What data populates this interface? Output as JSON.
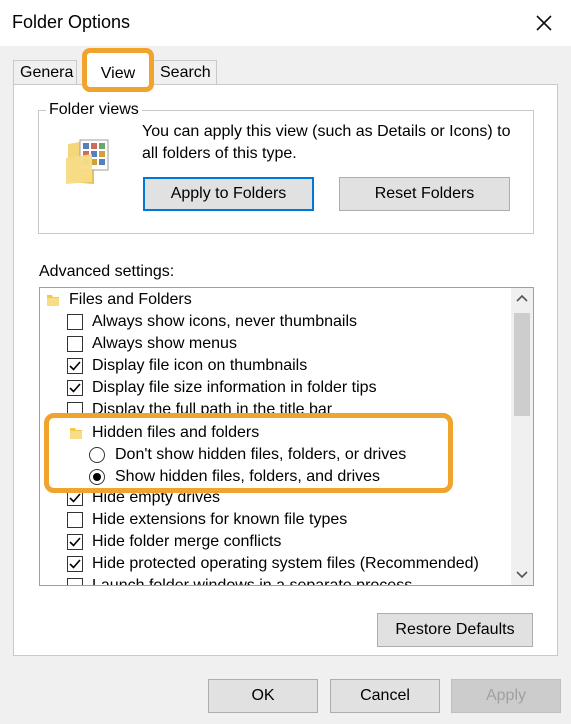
{
  "window": {
    "title": "Folder Options"
  },
  "tabs": [
    {
      "label": "Genera"
    },
    {
      "label": "View"
    },
    {
      "label": "Search"
    }
  ],
  "folder_views": {
    "label": "Folder views",
    "description": "You can apply this view (such as Details or Icons) to all folders of this type.",
    "apply_button": "Apply to Folders",
    "reset_button": "Reset Folders"
  },
  "advanced": {
    "label": "Advanced settings:",
    "items": [
      {
        "type": "folder",
        "label": "Files and Folders"
      },
      {
        "type": "checkbox",
        "label": "Always show icons, never thumbnails",
        "checked": false
      },
      {
        "type": "checkbox",
        "label": "Always show menus",
        "checked": false
      },
      {
        "type": "checkbox",
        "label": "Display file icon on thumbnails",
        "checked": true
      },
      {
        "type": "checkbox",
        "label": "Display file size information in folder tips",
        "checked": true
      },
      {
        "type": "checkbox",
        "label": "Display the full path in the title bar",
        "checked": false
      },
      {
        "type": "folder",
        "label": "Hidden files and folders"
      },
      {
        "type": "radio",
        "label": "Don't show hidden files, folders, or drives",
        "selected": false
      },
      {
        "type": "radio",
        "label": "Show hidden files, folders, and drives",
        "selected": true
      },
      {
        "type": "checkbox",
        "label": "Hide empty drives",
        "checked": true
      },
      {
        "type": "checkbox",
        "label": "Hide extensions for known file types",
        "checked": false
      },
      {
        "type": "checkbox",
        "label": "Hide folder merge conflicts",
        "checked": true
      },
      {
        "type": "checkbox",
        "label": "Hide protected operating system files (Recommended)",
        "checked": true
      },
      {
        "type": "checkbox",
        "label": "Launch folder windows in a separate process",
        "checked": false
      }
    ]
  },
  "buttons": {
    "restore": "Restore Defaults",
    "ok": "OK",
    "cancel": "Cancel",
    "apply": "Apply"
  },
  "colors": {
    "highlight": "#f0a42c",
    "focus": "#0078d7"
  }
}
